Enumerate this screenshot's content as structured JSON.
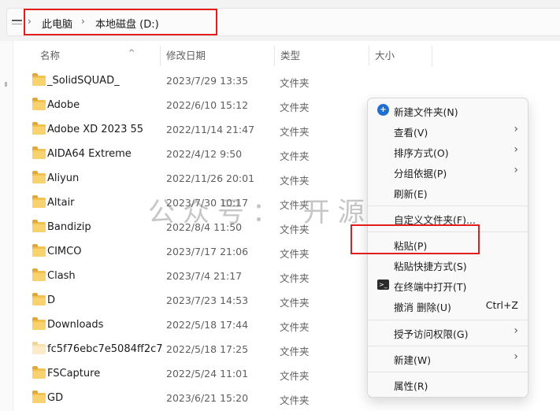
{
  "breadcrumb": {
    "items": [
      "此电脑",
      "本地磁盘 (D:)"
    ],
    "separator": "›"
  },
  "columns": {
    "name": "名称",
    "modified": "修改日期",
    "type": "类型",
    "size": "大小",
    "sort_indicator": "^"
  },
  "files": [
    {
      "name": "_SolidSQUAD_",
      "modified": "2023/7/29 13:35",
      "type": "文件夹"
    },
    {
      "name": "Adobe",
      "modified": "2022/6/10 15:12",
      "type": "文件夹"
    },
    {
      "name": "Adobe XD 2023 55",
      "modified": "2022/11/14 21:47",
      "type": "文件夹"
    },
    {
      "name": "AIDA64 Extreme",
      "modified": "2022/4/12 9:50",
      "type": "文件夹"
    },
    {
      "name": "Aliyun",
      "modified": "2022/11/26 20:01",
      "type": "文件夹"
    },
    {
      "name": "Altair",
      "modified": "2023/7/30 10:17",
      "type": "文件夹"
    },
    {
      "name": "Bandizip",
      "modified": "2022/8/4 11:50",
      "type": "文件夹"
    },
    {
      "name": "CIMCO",
      "modified": "2023/7/17 21:06",
      "type": "文件夹"
    },
    {
      "name": "Clash",
      "modified": "2023/7/4 21:17",
      "type": "文件夹"
    },
    {
      "name": "D",
      "modified": "2023/7/23 14:53",
      "type": "文件夹"
    },
    {
      "name": "Downloads",
      "modified": "2022/5/18 17:44",
      "type": "文件夹"
    },
    {
      "name": "fc5f76ebc7e5084ff2c7...",
      "modified": "2022/5/18 17:25",
      "type": "文件夹"
    },
    {
      "name": "FSCapture",
      "modified": "2022/5/24 11:01",
      "type": "文件夹"
    },
    {
      "name": "GD",
      "modified": "2023/6/21 15:20",
      "type": "文件夹"
    }
  ],
  "watermark": "公众号： 开源神器",
  "context_menu": {
    "new_folder": "新建文件夹(N)",
    "view": "查看(V)",
    "sort_by": "排序方式(O)",
    "group_by": "分组依据(P)",
    "refresh": "刷新(E)",
    "customize_folder": "自定义文件夹(F)...",
    "paste": "粘贴(P)",
    "paste_shortcut": "粘贴快捷方式(S)",
    "open_in_terminal": "在终端中打开(T)",
    "undo_delete": "撤消 删除(U)",
    "undo_shortcut": "Ctrl+Z",
    "give_access": "授予访问权限(G)",
    "new": "新建(W)",
    "properties": "属性(R)",
    "submenu_arrow": "›"
  },
  "colors": {
    "highlight_box": "#e11d1d",
    "folder": "#f2c14e",
    "accent": "#1e6fd0"
  }
}
